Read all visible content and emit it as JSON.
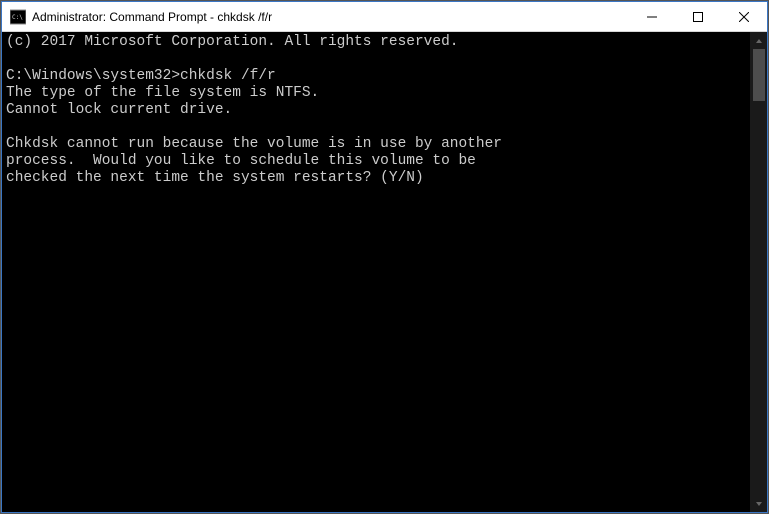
{
  "titlebar": {
    "icon_label": "cmd-icon",
    "icon_text": "C:\\",
    "title": "Administrator: Command Prompt - chkdsk  /f/r"
  },
  "console": {
    "lines": [
      "(c) 2017 Microsoft Corporation. All rights reserved.",
      "",
      "C:\\Windows\\system32>chkdsk /f/r",
      "The type of the file system is NTFS.",
      "Cannot lock current drive.",
      "",
      "Chkdsk cannot run because the volume is in use by another",
      "process.  Would you like to schedule this volume to be",
      "checked the next time the system restarts? (Y/N)"
    ]
  }
}
